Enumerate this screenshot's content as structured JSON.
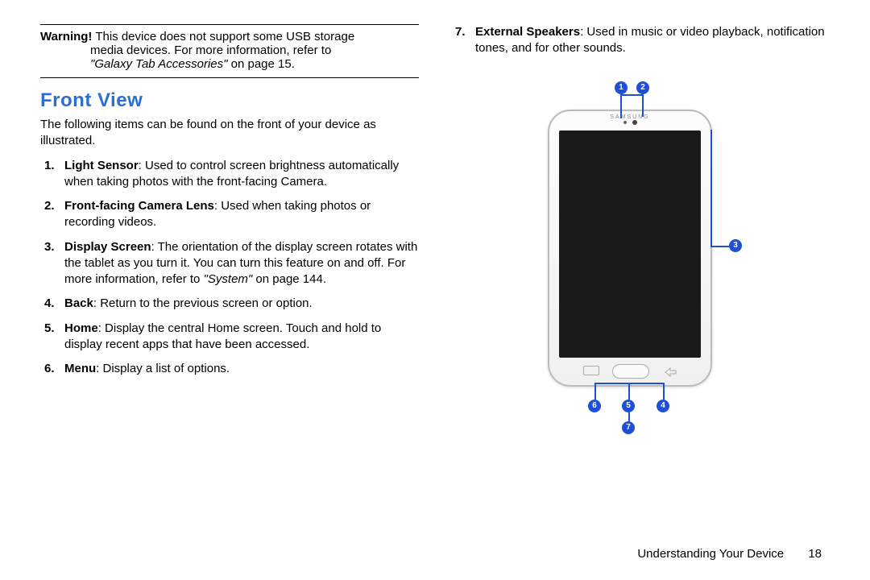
{
  "warning": {
    "label": "Warning!",
    "text_line1": " This device does not support some USB storage",
    "text_line2": "media devices. For more information, refer to ",
    "ref_italic": "\"Galaxy Tab Accessories\"",
    "ref_rest": " on page 15."
  },
  "section_title": "Front View",
  "intro": "The following items can be found on the front of your device as illustrated.",
  "items": {
    "i1": {
      "term": "Light Sensor",
      "text": ": Used to control screen brightness automatically when taking photos with the front-facing Camera."
    },
    "i2": {
      "term": "Front-facing Camera Lens",
      "text": ": Used when taking photos or recording videos."
    },
    "i3": {
      "term": "Display Screen",
      "text_a": ": The orientation of the display screen rotates with the tablet as you turn it. You can turn this feature on and off. For more information, refer to ",
      "ref_italic": "\"System\"",
      "ref_rest": " on page 144."
    },
    "i4": {
      "term": "Back",
      "text": ": Return to the previous screen or option."
    },
    "i5": {
      "term": "Home",
      "text": ": Display the central Home screen. Touch and hold to display recent apps that have been accessed."
    },
    "i6": {
      "term": "Menu",
      "text": ": Display a list of options."
    },
    "i7": {
      "term": "External Speakers",
      "text": ": Used in music or video playback, notification tones, and for other sounds."
    }
  },
  "diagram": {
    "brand": "SAMSUNG",
    "callouts": {
      "c1": "1",
      "c2": "2",
      "c3": "3",
      "c4": "4",
      "c5": "5",
      "c6": "6",
      "c7": "7"
    }
  },
  "footer": {
    "section": "Understanding Your Device",
    "page": "18"
  }
}
